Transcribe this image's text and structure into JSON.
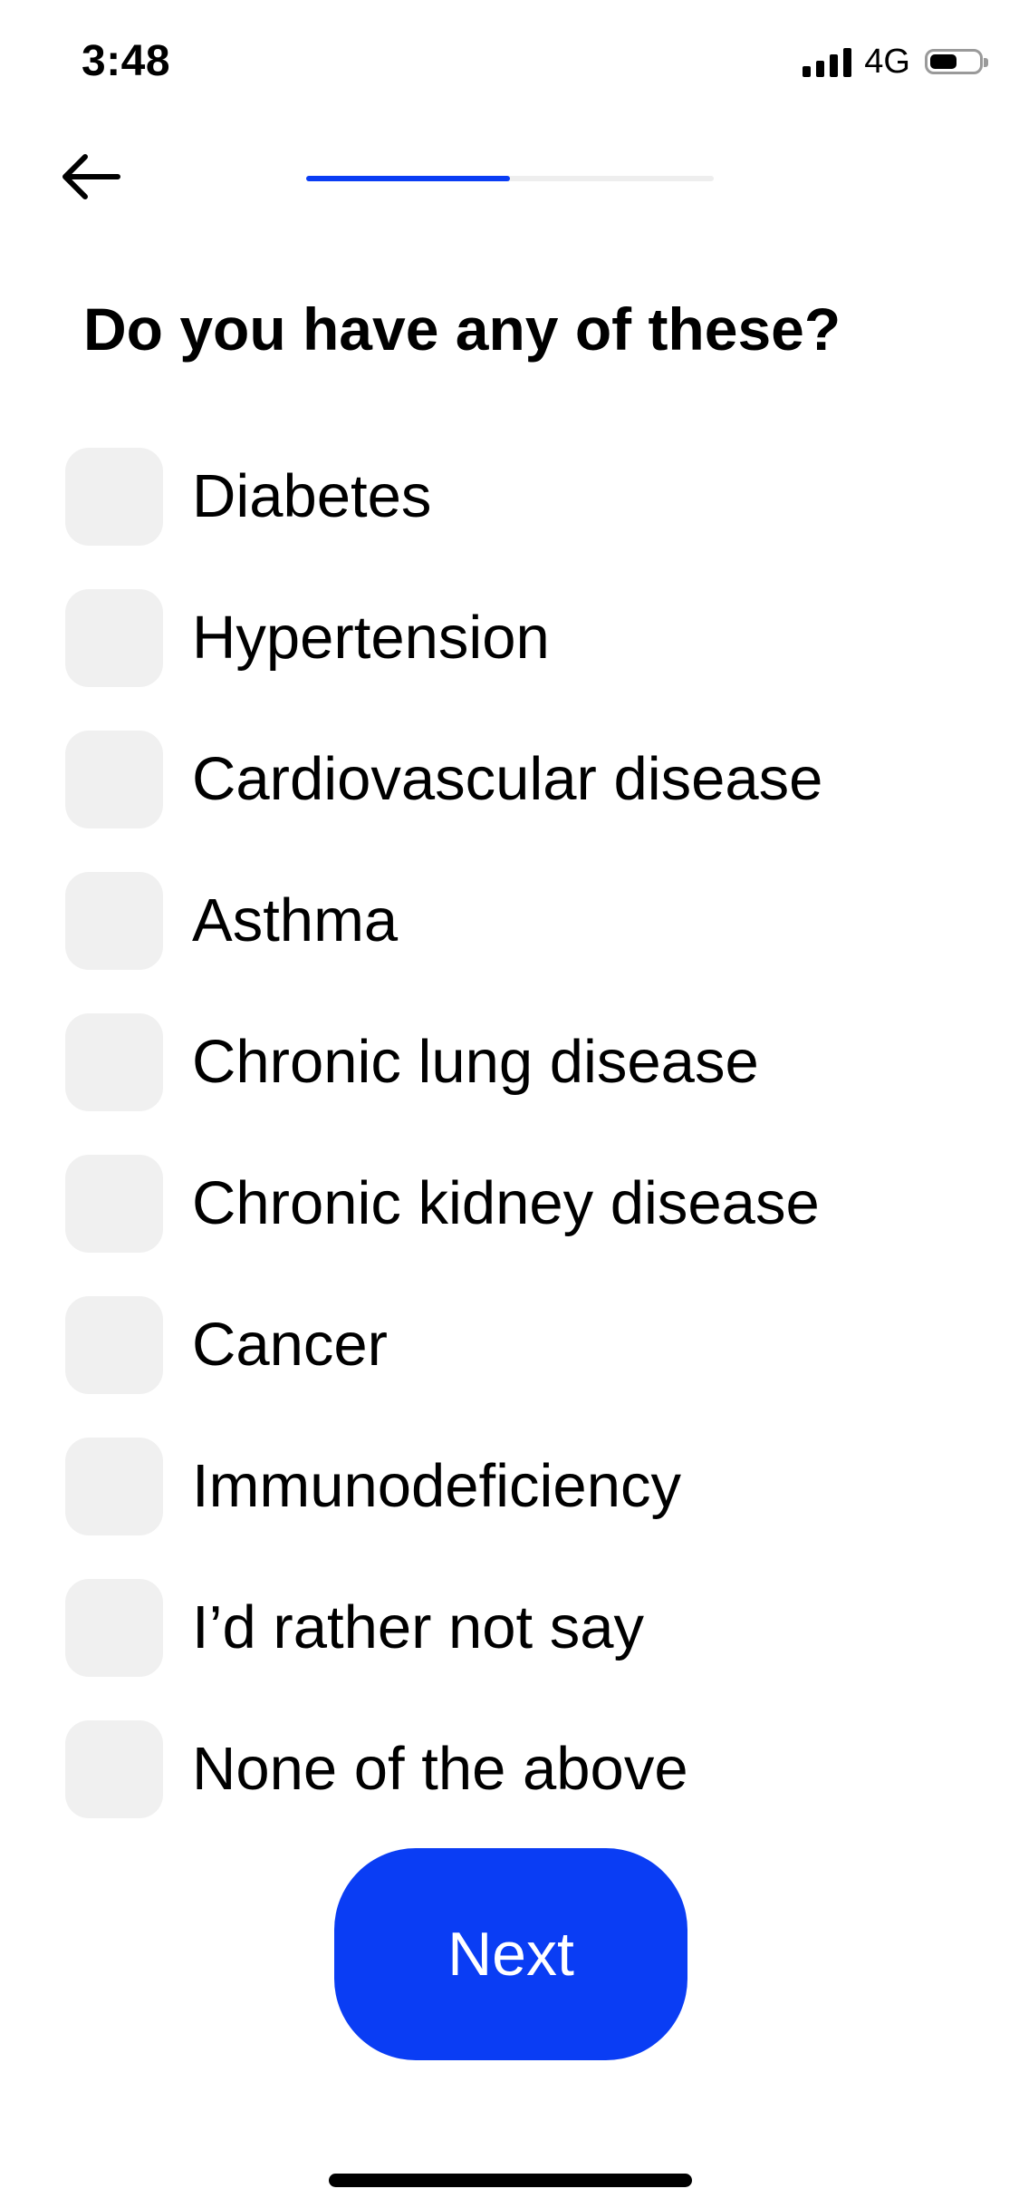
{
  "status_bar": {
    "time": "3:48",
    "network": "4G",
    "battery_level": 0.6
  },
  "navigation": {
    "back_icon": "arrow-left-icon",
    "progress_fraction": 0.5,
    "progress_color": "#0a3df4",
    "track_color": "#eeeeee"
  },
  "question": {
    "title": "Do you have any of these?"
  },
  "options": [
    {
      "label": "Diabetes",
      "checked": false
    },
    {
      "label": "Hypertension",
      "checked": false
    },
    {
      "label": "Cardiovascular disease",
      "checked": false
    },
    {
      "label": "Asthma",
      "checked": false
    },
    {
      "label": "Chronic lung disease",
      "checked": false
    },
    {
      "label": "Chronic kidney disease",
      "checked": false
    },
    {
      "label": "Cancer",
      "checked": false
    },
    {
      "label": "Immunodeficiency",
      "checked": false
    },
    {
      "label": "I’d rather not say",
      "checked": false
    },
    {
      "label": "None of the above",
      "checked": false
    }
  ],
  "next_button": {
    "label": "Next",
    "color": "#0a3df4"
  }
}
